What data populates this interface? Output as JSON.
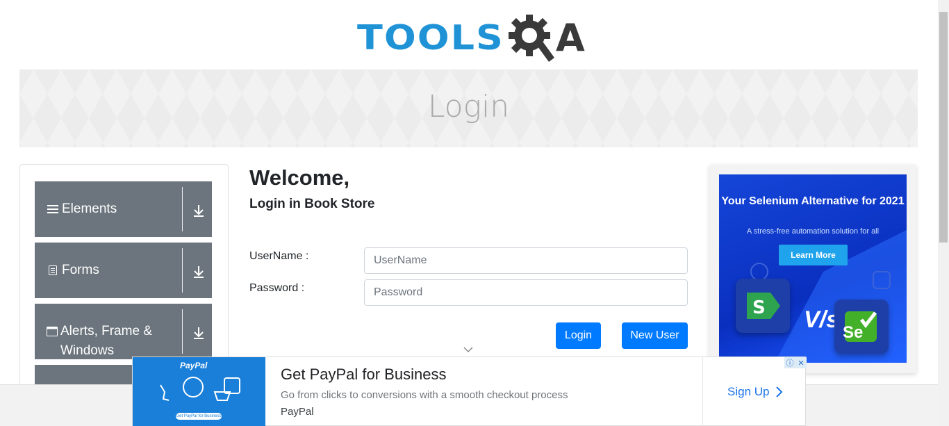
{
  "header": {
    "logo_tools": "TOOLS",
    "logo_q": "Q",
    "logo_a": "A"
  },
  "banner": {
    "title": "Login"
  },
  "sidebar": {
    "groups": [
      {
        "label": "Elements",
        "icon": "hamburger-icon"
      },
      {
        "label": "Forms",
        "icon": "document-icon"
      },
      {
        "label": "Alerts, Frame & Windows",
        "icon": "window-icon"
      }
    ]
  },
  "main": {
    "welcome": "Welcome,",
    "subtitle": "Login in Book Store",
    "username_label": "UserName :",
    "username_placeholder": "UserName",
    "password_label": "Password :",
    "password_placeholder": "Password",
    "login_button": "Login",
    "new_user_button": "New User"
  },
  "side_ad": {
    "headline": "Your Selenium Alternative for 2021",
    "subtext": "A stress-free automation solution for all",
    "cta": "Learn More",
    "vs_text": "V/s",
    "selenium_text": "Se"
  },
  "bottom_ad": {
    "image_brand": "PayPal",
    "image_small": "Get PayPal for Business",
    "title": "Get PayPal for Business",
    "description": "Go from clicks to conversions with a smooth checkout process",
    "brand": "PayPal",
    "cta": "Sign Up"
  },
  "colors": {
    "brand_blue": "#1f93d6",
    "primary_button": "#007bff",
    "sidebar_group": "#6c757d",
    "ad_blue": "#0a2fbf"
  }
}
